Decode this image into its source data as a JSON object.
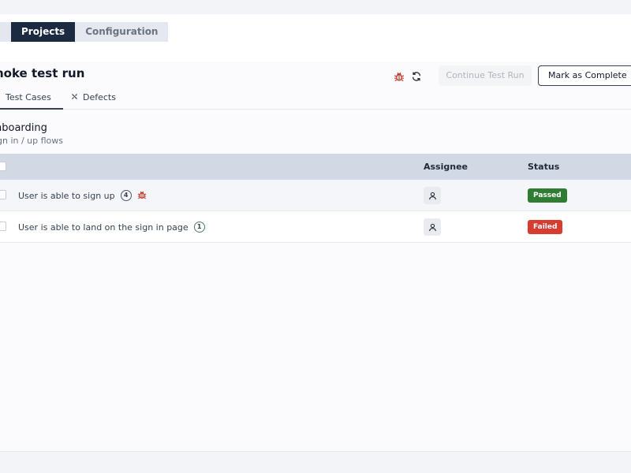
{
  "nav": {
    "tabs": [
      {
        "label": "Projects"
      },
      {
        "label": "Configuration"
      }
    ]
  },
  "run": {
    "title": "noke test run",
    "continue_label": "Continue Test Run",
    "complete_label": "Mark as Complete",
    "tabs": [
      {
        "label": "Test Cases"
      },
      {
        "label": "Defects"
      }
    ]
  },
  "section": {
    "title": "nboarding",
    "subtitle": "gn in / up flows"
  },
  "table": {
    "headers": {
      "assignee": "Assignee",
      "status": "Status"
    },
    "rows": [
      {
        "name": "User is able to sign up",
        "count": "4",
        "status": "Passed"
      },
      {
        "name": "User is able to land on the sign in page",
        "count": "1",
        "status": "Failed"
      }
    ]
  },
  "colors": {
    "nav_active": "#1b2a40",
    "passed": "#2e7d32",
    "failed": "#d63c2f",
    "bug_icon": "#c0392b"
  }
}
